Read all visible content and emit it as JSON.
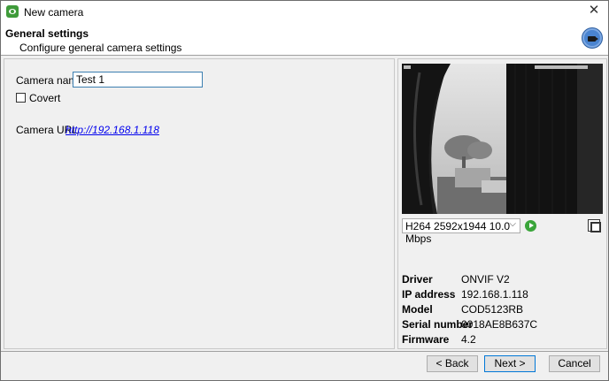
{
  "window": {
    "title": "New camera"
  },
  "header": {
    "title": "General settings",
    "subtitle": "Configure general camera settings"
  },
  "form": {
    "camera_name_label": "Camera name",
    "camera_name_value": "Test 1",
    "covert_label": "Covert",
    "covert_checked": false,
    "camera_url_label": "Camera URL",
    "camera_url_value": "http://192.168.1.118"
  },
  "preview": {
    "stream_selected": "H264 2592x1944 10.0 Mbps"
  },
  "info": [
    {
      "key": "Driver",
      "value": "ONVIF V2"
    },
    {
      "key": "IP address",
      "value": "192.168.1.118"
    },
    {
      "key": "Model",
      "value": "COD5123RB"
    },
    {
      "key": "Serial number",
      "value": "0018AE8B637C"
    },
    {
      "key": "Firmware",
      "value": "4.2"
    }
  ],
  "footer": {
    "back_label": "< Back",
    "next_label": "Next >",
    "cancel_label": "Cancel"
  },
  "icons": {
    "app": "eye-icon",
    "close": "close-icon",
    "header": "camera-icon",
    "play": "play-icon",
    "fullscreen": "fullscreen-icon",
    "dropdown": "chevron-down-icon"
  },
  "colors": {
    "accent": "#0078d7",
    "link": "#0000ee",
    "play": "#3aa53a",
    "app_icon": "#3f9b3a"
  }
}
